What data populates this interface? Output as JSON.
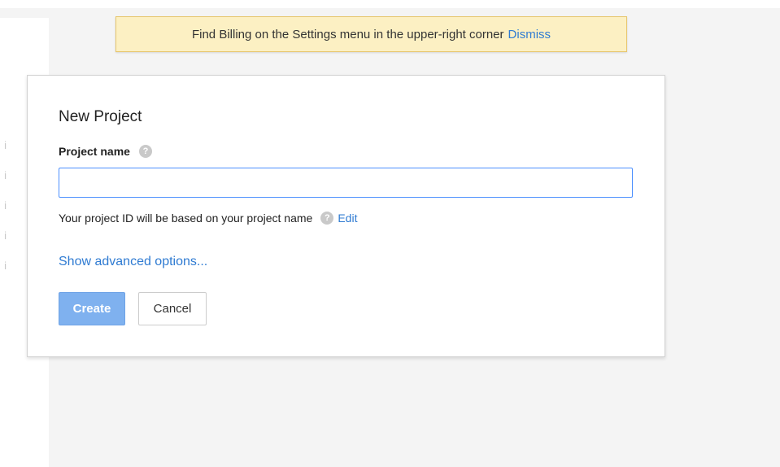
{
  "banner": {
    "message": "Find Billing on the Settings menu in the upper-right corner",
    "dismiss_label": "Dismiss"
  },
  "left_panel": {
    "rows": [
      "i",
      "i",
      "i",
      "i",
      "i"
    ]
  },
  "dialog": {
    "title": "New Project",
    "project_name_label": "Project name",
    "project_name_value": "",
    "help_glyph": "?",
    "project_id_note": "Your project ID will be based on your project name",
    "edit_label": "Edit",
    "advanced_label": "Show advanced options...",
    "create_label": "Create",
    "cancel_label": "Cancel"
  },
  "colors": {
    "link": "#2f7bd2",
    "banner_bg": "#fcf0c3",
    "create_bg": "#7fb1ef",
    "input_border": "#4d90fe"
  }
}
